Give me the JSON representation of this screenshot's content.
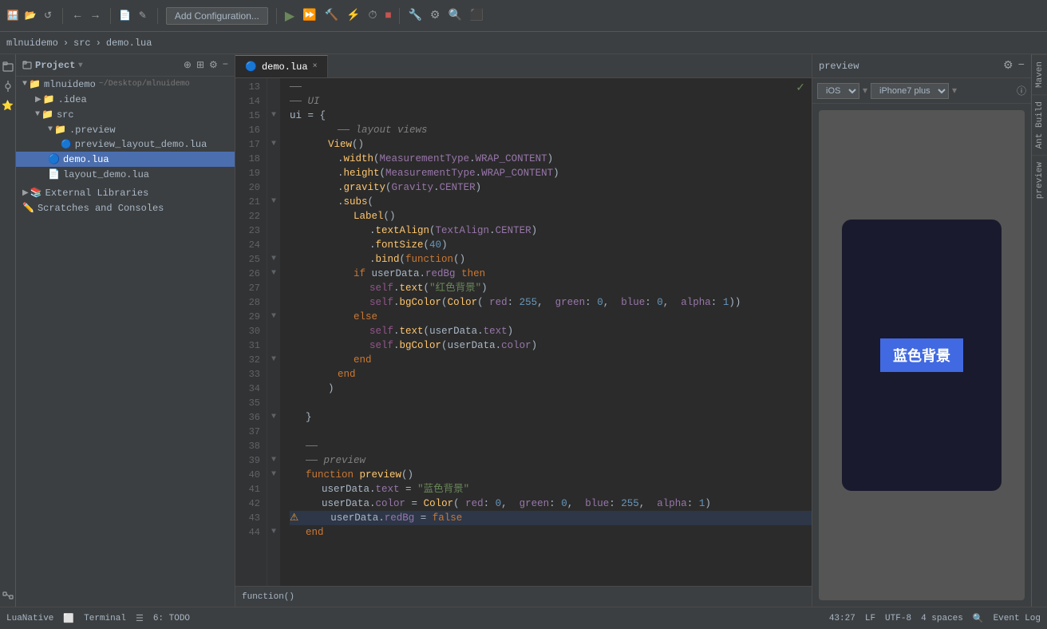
{
  "toolbar": {
    "add_config_label": "Add Configuration...",
    "project_icon": "📁",
    "undo_icon": "↩",
    "redo_icon": "↪"
  },
  "breadcrumb": {
    "project": "mlnuidemo",
    "sep1": "›",
    "folder": "src",
    "sep2": "›",
    "file": "demo.lua"
  },
  "sidebar": {
    "title": "Project",
    "root_item": "mlnuidemo",
    "root_path": "~/Desktop/mlnuidemo",
    "items": [
      {
        "label": ".idea",
        "type": "folder",
        "depth": 1
      },
      {
        "label": "src",
        "type": "folder",
        "depth": 1,
        "expanded": true
      },
      {
        "label": ".preview",
        "type": "folder",
        "depth": 2,
        "expanded": true
      },
      {
        "label": "preview_layout_demo.lua",
        "type": "lua",
        "depth": 3
      },
      {
        "label": "demo.lua",
        "type": "lua",
        "depth": 2,
        "selected": true
      },
      {
        "label": "layout_demo.lua",
        "type": "lua",
        "depth": 2
      },
      {
        "label": "External Libraries",
        "type": "lib",
        "depth": 0
      },
      {
        "label": "Scratches and Consoles",
        "type": "scratch",
        "depth": 0
      }
    ]
  },
  "tab": {
    "filename": "demo.lua",
    "icon": "🔵",
    "close": "×"
  },
  "editor": {
    "lines": [
      {
        "num": "13",
        "fold": "",
        "code": [
          {
            "t": "    ",
            "c": ""
          },
          {
            "t": "——",
            "c": "cmt"
          }
        ]
      },
      {
        "num": "14",
        "fold": "",
        "code": [
          {
            "t": "    ",
            "c": ""
          },
          {
            "t": "——",
            "c": "cmt"
          },
          {
            "t": " UI",
            "c": "cmt"
          }
        ]
      },
      {
        "num": "15",
        "fold": "▼",
        "code": [
          {
            "t": "    ",
            "c": ""
          },
          {
            "t": "ui",
            "c": "var"
          },
          {
            "t": " = ",
            "c": "op"
          },
          {
            "t": "{",
            "c": "op"
          }
        ]
      },
      {
        "num": "16",
        "fold": "",
        "code": [
          {
            "t": "        ",
            "c": ""
          },
          {
            "t": "——",
            "c": "cmt"
          },
          {
            "t": " layout views",
            "c": "cmt"
          }
        ]
      },
      {
        "num": "17",
        "fold": "▼",
        "code": [
          {
            "t": "        ",
            "c": ""
          },
          {
            "t": "View",
            "c": "fn"
          },
          {
            "t": "()",
            "c": "op"
          }
        ]
      },
      {
        "num": "18",
        "fold": "",
        "code": [
          {
            "t": "            ",
            "c": ""
          },
          {
            "t": ".",
            "c": "op"
          },
          {
            "t": "width",
            "c": "method"
          },
          {
            "t": "(",
            "c": "op"
          },
          {
            "t": "MeasurementType",
            "c": "param"
          },
          {
            "t": ".",
            "c": "op"
          },
          {
            "t": "WRAP_CONTENT",
            "c": "param"
          },
          {
            "t": ")",
            "c": "op"
          }
        ]
      },
      {
        "num": "19",
        "fold": "",
        "code": [
          {
            "t": "            ",
            "c": ""
          },
          {
            "t": ".",
            "c": "op"
          },
          {
            "t": "height",
            "c": "method"
          },
          {
            "t": "(",
            "c": "op"
          },
          {
            "t": "MeasurementType",
            "c": "param"
          },
          {
            "t": ".",
            "c": "op"
          },
          {
            "t": "WRAP_CONTENT",
            "c": "param"
          },
          {
            "t": ")",
            "c": "op"
          }
        ]
      },
      {
        "num": "20",
        "fold": "",
        "code": [
          {
            "t": "            ",
            "c": ""
          },
          {
            "t": ".",
            "c": "op"
          },
          {
            "t": "gravity",
            "c": "method"
          },
          {
            "t": "(",
            "c": "op"
          },
          {
            "t": "Gravity",
            "c": "param"
          },
          {
            "t": ".",
            "c": "op"
          },
          {
            "t": "CENTER",
            "c": "param"
          },
          {
            "t": ")",
            "c": "op"
          }
        ]
      },
      {
        "num": "21",
        "fold": "▼",
        "code": [
          {
            "t": "            ",
            "c": ""
          },
          {
            "t": ".",
            "c": "op"
          },
          {
            "t": "subs",
            "c": "method"
          },
          {
            "t": "(",
            "c": "op"
          }
        ]
      },
      {
        "num": "22",
        "fold": "",
        "code": [
          {
            "t": "                ",
            "c": ""
          },
          {
            "t": "Label",
            "c": "fn"
          },
          {
            "t": "()",
            "c": "op"
          }
        ]
      },
      {
        "num": "23",
        "fold": "",
        "code": [
          {
            "t": "                    ",
            "c": ""
          },
          {
            "t": ".",
            "c": "op"
          },
          {
            "t": "textAlign",
            "c": "method"
          },
          {
            "t": "(",
            "c": "op"
          },
          {
            "t": "TextAlign",
            "c": "param"
          },
          {
            "t": ".",
            "c": "op"
          },
          {
            "t": "CENTER",
            "c": "param"
          },
          {
            "t": ")",
            "c": "op"
          }
        ]
      },
      {
        "num": "24",
        "fold": "",
        "code": [
          {
            "t": "                    ",
            "c": ""
          },
          {
            "t": ".",
            "c": "op"
          },
          {
            "t": "fontSize",
            "c": "method"
          },
          {
            "t": "(",
            "c": "op"
          },
          {
            "t": "40",
            "c": "num"
          },
          {
            "t": ")",
            "c": "op"
          }
        ]
      },
      {
        "num": "25",
        "fold": "▼",
        "code": [
          {
            "t": "                    ",
            "c": ""
          },
          {
            "t": ".",
            "c": "op"
          },
          {
            "t": "bind",
            "c": "method"
          },
          {
            "t": "(",
            "c": "op"
          },
          {
            "t": "function",
            "c": "kw"
          },
          {
            "t": "()",
            "c": "op"
          }
        ]
      },
      {
        "num": "26",
        "fold": "▼",
        "code": [
          {
            "t": "                ",
            "c": ""
          },
          {
            "t": "if ",
            "c": "kw"
          },
          {
            "t": "userData",
            "c": "var"
          },
          {
            "t": ".",
            "c": "op"
          },
          {
            "t": "redBg",
            "c": "prop"
          },
          {
            "t": " ",
            "c": ""
          },
          {
            "t": "then",
            "c": "kw"
          }
        ]
      },
      {
        "num": "27",
        "fold": "",
        "code": [
          {
            "t": "                    ",
            "c": ""
          },
          {
            "t": "self",
            "c": "self-kw"
          },
          {
            "t": ".",
            "c": "op"
          },
          {
            "t": "text",
            "c": "method"
          },
          {
            "t": "(",
            "c": "op"
          },
          {
            "t": "\"红色背景\"",
            "c": "str"
          },
          {
            "t": ")",
            "c": "op"
          }
        ]
      },
      {
        "num": "28",
        "fold": "",
        "code": [
          {
            "t": "                    ",
            "c": ""
          },
          {
            "t": "self",
            "c": "self-kw"
          },
          {
            "t": ".",
            "c": "op"
          },
          {
            "t": "bgColor",
            "c": "method"
          },
          {
            "t": "(",
            "c": "op"
          },
          {
            "t": "Color",
            "c": "fn"
          },
          {
            "t": "( ",
            "c": "op"
          },
          {
            "t": "red",
            "c": "param"
          },
          {
            "t": ": ",
            "c": "op"
          },
          {
            "t": "255",
            "c": "num"
          },
          {
            "t": ",  ",
            "c": "op"
          },
          {
            "t": "green",
            "c": "param"
          },
          {
            "t": ": ",
            "c": "op"
          },
          {
            "t": "0",
            "c": "num"
          },
          {
            "t": ",  ",
            "c": "op"
          },
          {
            "t": "blue",
            "c": "param"
          },
          {
            "t": ": ",
            "c": "op"
          },
          {
            "t": "0",
            "c": "num"
          },
          {
            "t": ",  ",
            "c": "op"
          },
          {
            "t": "alpha",
            "c": "param"
          },
          {
            "t": ": ",
            "c": "op"
          },
          {
            "t": "1",
            "c": "num"
          },
          {
            "t": "))",
            "c": "op"
          }
        ]
      },
      {
        "num": "29",
        "fold": "▼",
        "code": [
          {
            "t": "                ",
            "c": ""
          },
          {
            "t": "else",
            "c": "kw"
          }
        ]
      },
      {
        "num": "30",
        "fold": "",
        "code": [
          {
            "t": "                    ",
            "c": ""
          },
          {
            "t": "self",
            "c": "self-kw"
          },
          {
            "t": ".",
            "c": "op"
          },
          {
            "t": "text",
            "c": "method"
          },
          {
            "t": "(",
            "c": "op"
          },
          {
            "t": "userData",
            "c": "var"
          },
          {
            "t": ".",
            "c": "op"
          },
          {
            "t": "text",
            "c": "prop"
          },
          {
            "t": ")",
            "c": "op"
          }
        ]
      },
      {
        "num": "31",
        "fold": "",
        "code": [
          {
            "t": "                    ",
            "c": ""
          },
          {
            "t": "self",
            "c": "self-kw"
          },
          {
            "t": ".",
            "c": "op"
          },
          {
            "t": "bgColor",
            "c": "method"
          },
          {
            "t": "(",
            "c": "op"
          },
          {
            "t": "userData",
            "c": "var"
          },
          {
            "t": ".",
            "c": "op"
          },
          {
            "t": "color",
            "c": "prop"
          },
          {
            "t": ")",
            "c": "op"
          }
        ]
      },
      {
        "num": "32",
        "fold": "▼",
        "code": [
          {
            "t": "                ",
            "c": ""
          },
          {
            "t": "end",
            "c": "kw"
          }
        ]
      },
      {
        "num": "33",
        "fold": "",
        "code": [
          {
            "t": "            ",
            "c": ""
          },
          {
            "t": "end",
            "c": "kw"
          }
        ]
      },
      {
        "num": "34",
        "fold": "",
        "code": [
          {
            "t": "        ",
            "c": ""
          },
          {
            "t": ")",
            "c": "op"
          }
        ]
      },
      {
        "num": "35",
        "fold": "",
        "code": []
      },
      {
        "num": "36",
        "fold": "▼",
        "code": [
          {
            "t": "    ",
            "c": ""
          },
          {
            "t": "}",
            "c": "op"
          }
        ]
      },
      {
        "num": "37",
        "fold": "",
        "code": []
      },
      {
        "num": "38",
        "fold": "",
        "code": [
          {
            "t": "    ",
            "c": ""
          },
          {
            "t": "——",
            "c": "cmt"
          }
        ]
      },
      {
        "num": "39",
        "fold": "▼",
        "code": [
          {
            "t": "    ",
            "c": ""
          },
          {
            "t": "——",
            "c": "cmt"
          },
          {
            "t": " preview",
            "c": "cmt"
          }
        ]
      },
      {
        "num": "40",
        "fold": "▼",
        "code": [
          {
            "t": "    ",
            "c": ""
          },
          {
            "t": "function ",
            "c": "kw"
          },
          {
            "t": "preview",
            "c": "fn"
          },
          {
            "t": "()",
            "c": "op"
          }
        ]
      },
      {
        "num": "41",
        "fold": "",
        "code": [
          {
            "t": "        ",
            "c": ""
          },
          {
            "t": "userData",
            "c": "var"
          },
          {
            "t": ".",
            "c": "op"
          },
          {
            "t": "text",
            "c": "prop"
          },
          {
            "t": " = ",
            "c": "op"
          },
          {
            "t": "\"蓝色背景\"",
            "c": "str"
          }
        ]
      },
      {
        "num": "42",
        "fold": "",
        "code": [
          {
            "t": "        ",
            "c": ""
          },
          {
            "t": "userData",
            "c": "var"
          },
          {
            "t": ".",
            "c": "op"
          },
          {
            "t": "color",
            "c": "prop"
          },
          {
            "t": " = ",
            "c": "op"
          },
          {
            "t": "Color",
            "c": "fn"
          },
          {
            "t": "( ",
            "c": "op"
          },
          {
            "t": "red",
            "c": "param"
          },
          {
            "t": ": ",
            "c": "op"
          },
          {
            "t": "0",
            "c": "num"
          },
          {
            "t": ",  ",
            "c": "op"
          },
          {
            "t": "green",
            "c": "param"
          },
          {
            "t": ": ",
            "c": "op"
          },
          {
            "t": "0",
            "c": "num"
          },
          {
            "t": ",  ",
            "c": "op"
          },
          {
            "t": "blue",
            "c": "param"
          },
          {
            "t": ": ",
            "c": "op"
          },
          {
            "t": "255",
            "c": "num"
          },
          {
            "t": ",  ",
            "c": "op"
          },
          {
            "t": "alpha",
            "c": "param"
          },
          {
            "t": ": ",
            "c": "op"
          },
          {
            "t": "1",
            "c": "num"
          },
          {
            "t": ")",
            "c": "op"
          }
        ]
      },
      {
        "num": "43",
        "fold": "",
        "code": [
          {
            "t": "        ",
            "c": ""
          },
          {
            "t": "userData",
            "c": "var"
          },
          {
            "t": ".",
            "c": "op"
          },
          {
            "t": "redBg",
            "c": "prop"
          },
          {
            "t": " = ",
            "c": "op"
          },
          {
            "t": "false",
            "c": "kw"
          }
        ],
        "warn": true
      },
      {
        "num": "44",
        "fold": "▼",
        "code": [
          {
            "t": "    ",
            "c": ""
          },
          {
            "t": "end",
            "c": "kw"
          }
        ]
      }
    ]
  },
  "preview": {
    "title": "preview",
    "device_label": "iOS",
    "model_label": "iPhone7 plus",
    "phone_text": "蓝色背景",
    "gear_icon": "⚙",
    "minus_icon": "−",
    "info_icon": "ⓘ",
    "arrow_icon": "▾"
  },
  "right_tools": {
    "items": [
      "Maven",
      "Ant Build",
      "preview"
    ]
  },
  "bottom_bar": {
    "luanative": "LuaNative",
    "terminal": "Terminal",
    "todo": "6: TODO"
  },
  "status_bar": {
    "position": "43:27",
    "line_ending": "LF",
    "encoding": "UTF-8",
    "indent": "4 spaces",
    "event_log": "Event Log"
  },
  "green_check": "✓"
}
